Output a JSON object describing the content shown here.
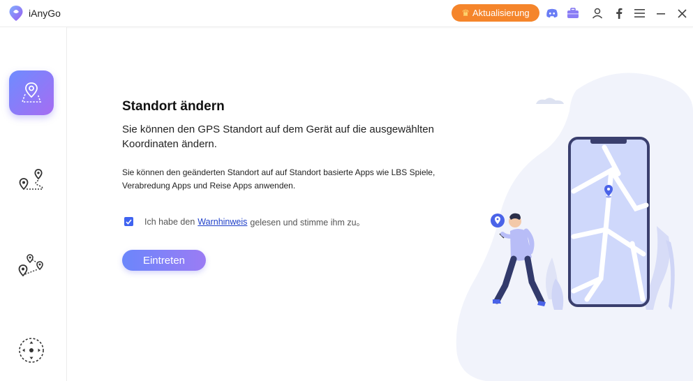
{
  "app": {
    "name": "iAnyGo"
  },
  "header": {
    "update_label": "Aktualisierung",
    "icons": [
      "discord-icon",
      "toolbox-icon",
      "account-icon",
      "facebook-icon",
      "menu-icon",
      "minimize-icon",
      "close-icon"
    ]
  },
  "sidebar": {
    "items": [
      {
        "name": "change-location",
        "icon": "location-pin-map-icon",
        "active": true
      },
      {
        "name": "two-spot-movement",
        "icon": "two-pins-route-icon",
        "active": false
      },
      {
        "name": "multi-spot-movement",
        "icon": "multi-pins-route-icon",
        "active": false
      },
      {
        "name": "joystick-movement",
        "icon": "joystick-icon",
        "active": false
      }
    ]
  },
  "main": {
    "title": "Standort ändern",
    "description": "Sie können den GPS Standort auf dem Gerät auf die ausgewählten Koordinaten ändern.",
    "note": "Sie können den geänderten Standort auf auf Standort basierte Apps wie LBS Spiele, Verabredung Apps und Reise Apps anwenden.",
    "agree_prefix": "Ich habe den",
    "agree_link": "Warnhinweis",
    "agree_suffix": "gelesen und stimme ihm zu。",
    "agree_checked": true,
    "enter_label": "Eintreten"
  },
  "colors": {
    "accent": "#6b86fb",
    "accent2": "#9b7cf4",
    "update": "#f5852b",
    "checkbox": "#3f63f0",
    "link": "#1e3fc8"
  }
}
